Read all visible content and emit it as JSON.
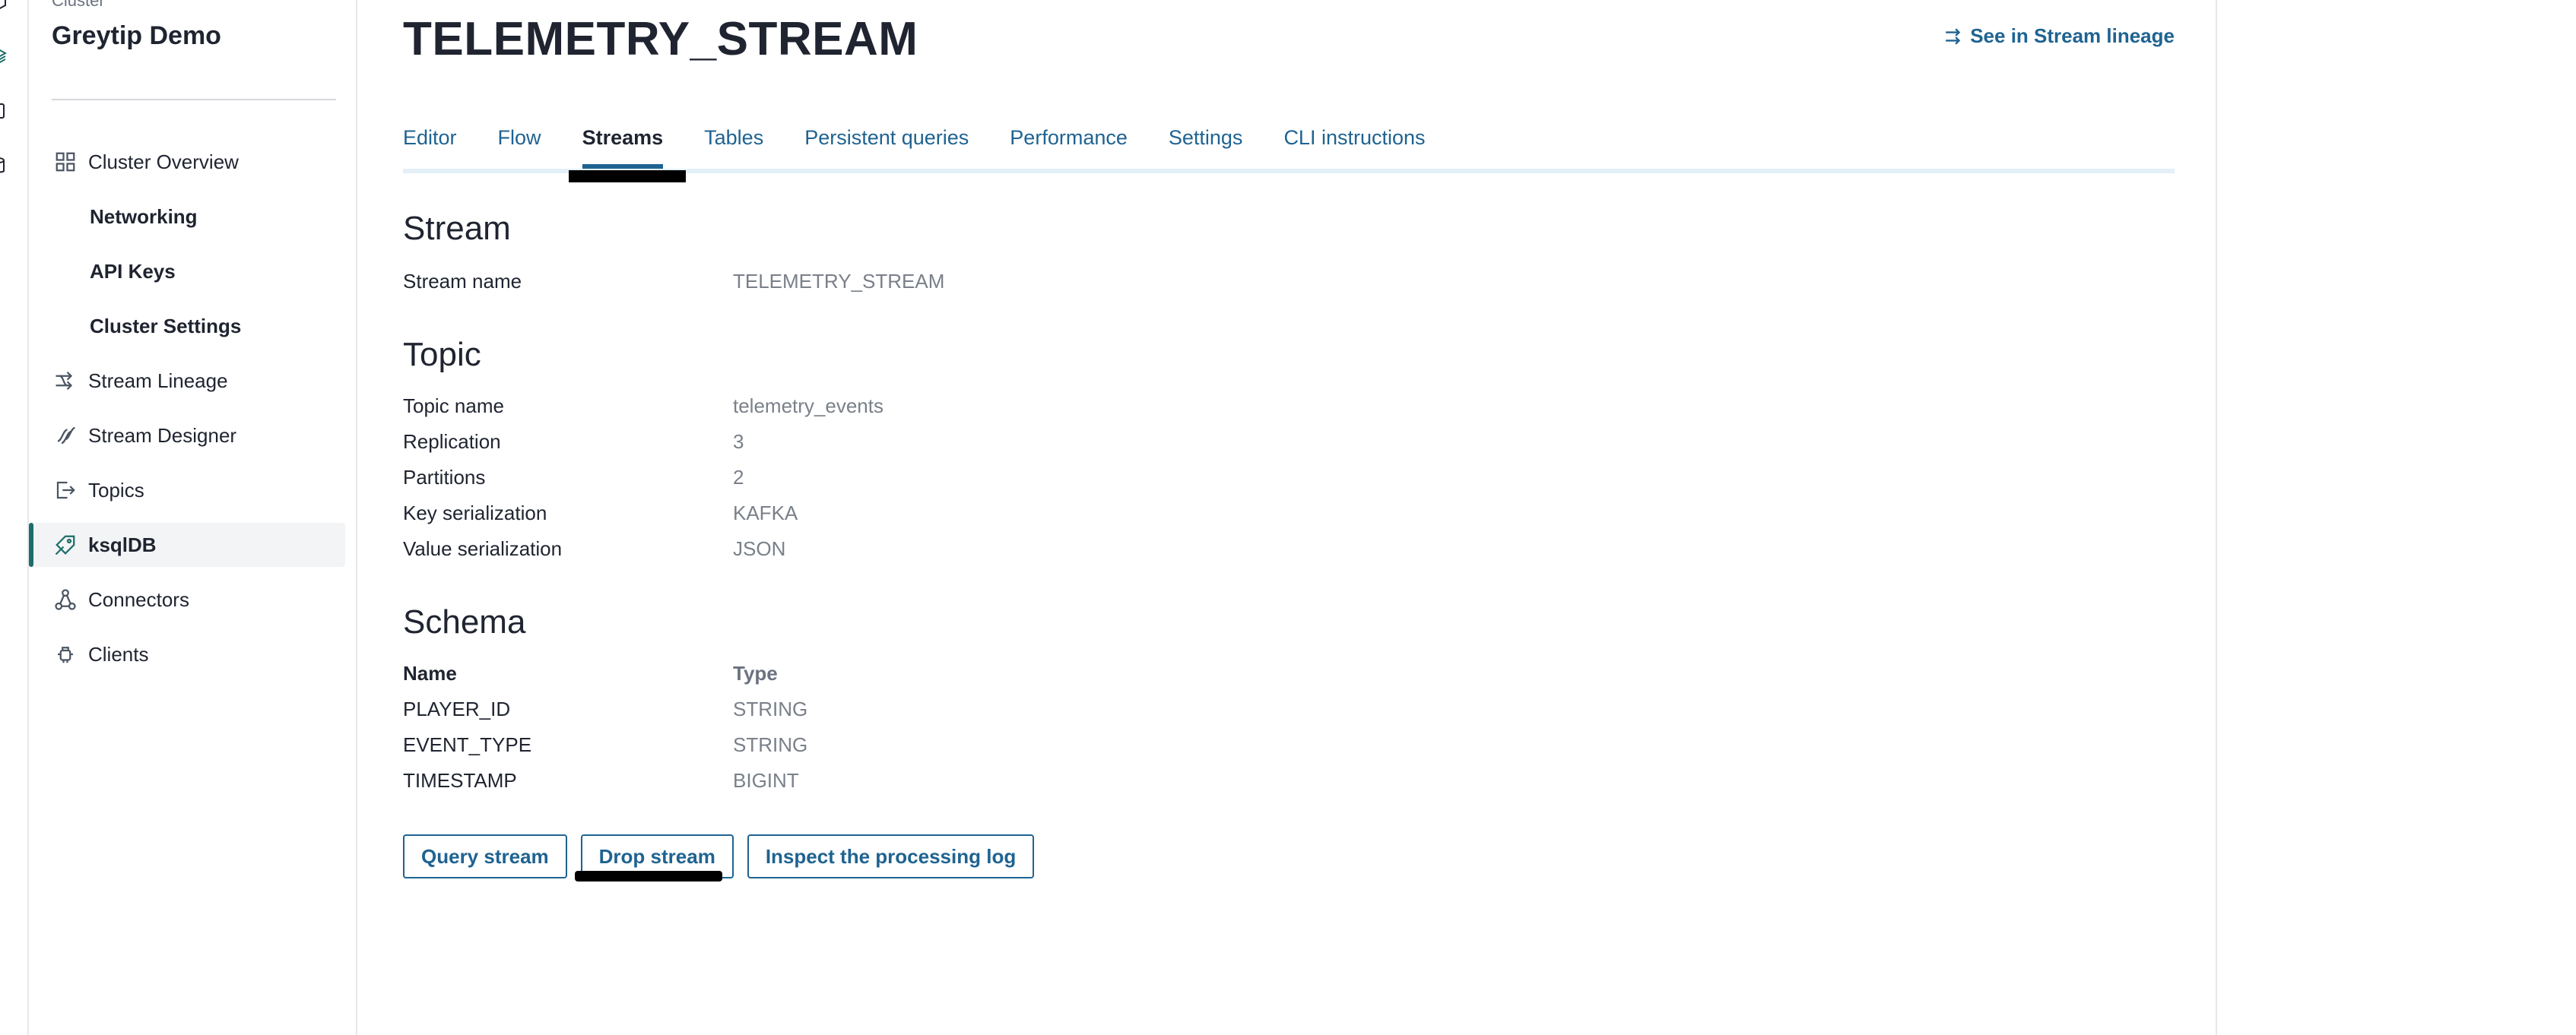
{
  "rail": {
    "icons": [
      "cube-icon",
      "layers-icon",
      "document-icon",
      "database-icon"
    ]
  },
  "sidebar": {
    "cluster_caption": "Cluster",
    "cluster_name": "Greytip Demo",
    "items": [
      {
        "label": "Cluster Overview",
        "icon": "grid-icon"
      },
      {
        "label": "Networking",
        "icon": ""
      },
      {
        "label": "API Keys",
        "icon": ""
      },
      {
        "label": "Cluster Settings",
        "icon": ""
      },
      {
        "label": "Stream Lineage",
        "icon": "lineage-icon"
      },
      {
        "label": "Stream Designer",
        "icon": "designer-icon"
      },
      {
        "label": "Topics",
        "icon": "topics-icon"
      },
      {
        "label": "ksqlDB",
        "icon": "ksqldb-icon",
        "active": true
      },
      {
        "label": "Connectors",
        "icon": "connectors-icon"
      },
      {
        "label": "Clients",
        "icon": "clients-icon"
      }
    ]
  },
  "header": {
    "title": "TELEMETRY_STREAM",
    "lineage_link": "See in Stream lineage"
  },
  "tabs": [
    {
      "label": "Editor"
    },
    {
      "label": "Flow"
    },
    {
      "label": "Streams",
      "active": true
    },
    {
      "label": "Tables"
    },
    {
      "label": "Persistent queries"
    },
    {
      "label": "Performance"
    },
    {
      "label": "Settings"
    },
    {
      "label": "CLI instructions"
    }
  ],
  "stream": {
    "heading": "Stream",
    "name_label": "Stream name",
    "name_value": "TELEMETRY_STREAM"
  },
  "topic": {
    "heading": "Topic",
    "rows": [
      {
        "key": "Topic name",
        "value": "telemetry_events"
      },
      {
        "key": "Replication",
        "value": "3"
      },
      {
        "key": "Partitions",
        "value": "2"
      },
      {
        "key": "Key serialization",
        "value": "KAFKA"
      },
      {
        "key": "Value serialization",
        "value": "JSON"
      }
    ]
  },
  "schema": {
    "heading": "Schema",
    "col_name": "Name",
    "col_type": "Type",
    "rows": [
      {
        "name": "PLAYER_ID",
        "type": "STRING"
      },
      {
        "name": "EVENT_TYPE",
        "type": "STRING"
      },
      {
        "name": "TIMESTAMP",
        "type": "BIGINT"
      }
    ]
  },
  "actions": {
    "query": "Query stream",
    "drop": "Drop stream",
    "inspect": "Inspect the processing log"
  },
  "colors": {
    "accent": "#1f6391",
    "active_indicator": "#1d6d6a",
    "tab_rule": "#e3f0f8"
  }
}
